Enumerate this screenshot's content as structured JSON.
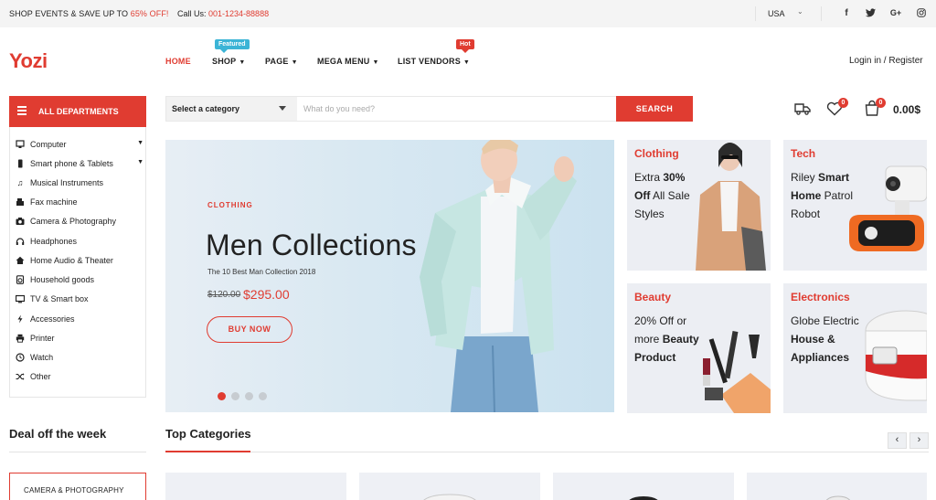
{
  "topbar": {
    "promo_prefix": "SHOP EVENTS & SAVE UP TO ",
    "promo_highlight": "65% OFF!",
    "call_label": "Call Us: ",
    "call_number": "001-1234-88888",
    "currency": "USA",
    "social_icons": [
      "facebook-icon",
      "twitter-icon",
      "google-plus-icon",
      "instagram-icon"
    ]
  },
  "header": {
    "logo": "Yozi",
    "nav": [
      {
        "label": "HOME",
        "active": true
      },
      {
        "label": "SHOP",
        "badge": "Featured"
      },
      {
        "label": "PAGE"
      },
      {
        "label": "MEGA MENU"
      },
      {
        "label": "LIST VENDORS",
        "badge": "Hot"
      }
    ],
    "login": "Login in / Register"
  },
  "departments": {
    "title": "ALL DEPARTMENTS",
    "items": [
      {
        "label": "Computer",
        "icon": "monitor-icon",
        "has_sub": true
      },
      {
        "label": "Smart phone & Tablets",
        "icon": "phone-icon",
        "has_sub": true
      },
      {
        "label": "Musical Instruments",
        "icon": "music-note-icon"
      },
      {
        "label": "Fax machine",
        "icon": "fax-icon"
      },
      {
        "label": "Camera & Photography",
        "icon": "camera-icon"
      },
      {
        "label": "Headphones",
        "icon": "headphones-icon"
      },
      {
        "label": "Home Audio & Theater",
        "icon": "home-icon"
      },
      {
        "label": "Household goods",
        "icon": "washer-icon"
      },
      {
        "label": "TV & Smart box",
        "icon": "tv-icon"
      },
      {
        "label": "Accessories",
        "icon": "lightning-icon"
      },
      {
        "label": "Printer",
        "icon": "printer-icon"
      },
      {
        "label": "Watch",
        "icon": "clock-icon"
      },
      {
        "label": "Other",
        "icon": "shuffle-icon"
      }
    ]
  },
  "search": {
    "category": "Select a category",
    "placeholder": "What do you need?",
    "button": "SEARCH"
  },
  "header_icons": {
    "wishlist_count": "0",
    "cart_count": "0",
    "cart_total": "0.00$"
  },
  "hero": {
    "kicker": "CLOTHING",
    "title": "Men Collections",
    "subtitle": "The 10 Best Man Collection 2018",
    "old_price": "$120.00",
    "new_price": "$295.00",
    "cta": "BUY NOW",
    "slides": 4,
    "active_slide": 1
  },
  "tiles": {
    "clothing": {
      "name": "Clothing",
      "l1a": "Extra ",
      "l1b": "30%",
      "l2a": "Off",
      "l2b": " All Sale",
      "l3": "Styles"
    },
    "tech": {
      "name": "Tech",
      "l1a": "Riley ",
      "l1b": "Smart",
      "l2a": "Home",
      "l2b": " Patrol",
      "l3": "Robot"
    },
    "beauty": {
      "name": "Beauty",
      "l1": "20% Off or",
      "l2a": "more ",
      "l2b": "Beauty",
      "l3": "Product"
    },
    "electronics": {
      "name": "Electronics",
      "l1": "Globe Electric",
      "l2": "House &",
      "l3": "Appliances"
    }
  },
  "sections": {
    "deal_title": "Deal off the week",
    "deal_tab": "CAMERA & PHOTOGRAPHY",
    "top_categories": "Top Categories",
    "prev": "‹",
    "next": "›"
  },
  "colors": {
    "accent": "#e03c31",
    "featured": "#3bb4d6",
    "topbar_bg": "#f4f4f4",
    "tile_bg": "#eceef3"
  }
}
